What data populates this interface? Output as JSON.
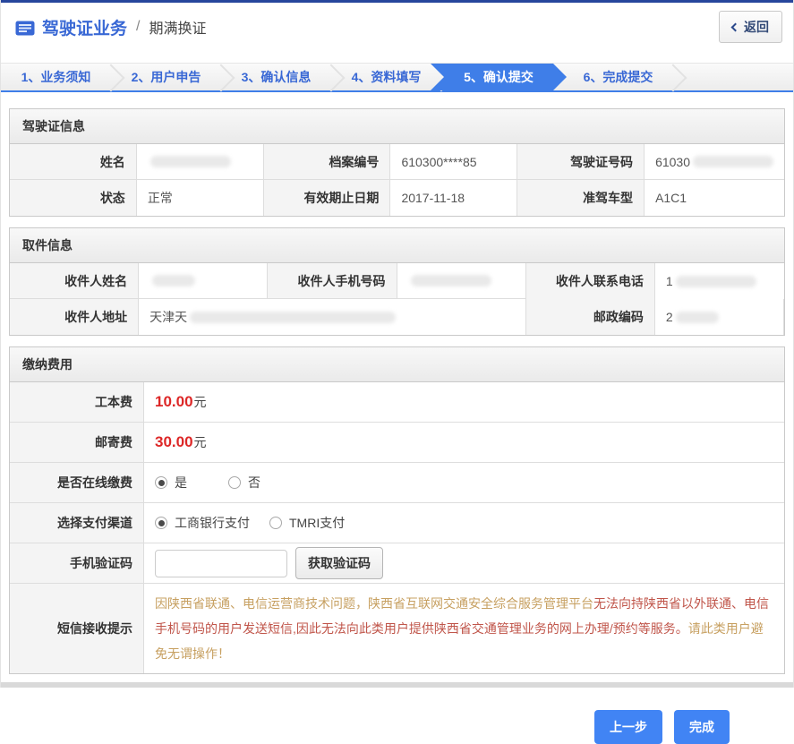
{
  "header": {
    "app_title": "驾驶证业务",
    "separator": "/",
    "subtitle": "期满换证",
    "back_label": "返回"
  },
  "steps": [
    {
      "label": "1、业务须知"
    },
    {
      "label": "2、用户申告"
    },
    {
      "label": "3、确认信息"
    },
    {
      "label": "4、资料填写"
    },
    {
      "label": "5、确认提交"
    },
    {
      "label": "6、完成提交"
    }
  ],
  "license": {
    "title": "驾驶证信息",
    "name_label": "姓名",
    "file_no_label": "档案编号",
    "file_no_value": "610300****85",
    "license_no_label": "驾驶证号码",
    "license_no_value_visible": "61030",
    "status_label": "状态",
    "status_value": "正常",
    "expiry_label": "有效期止日期",
    "expiry_value": "2017-11-18",
    "vehicle_label": "准驾车型",
    "vehicle_value": "A1C1"
  },
  "pickup": {
    "title": "取件信息",
    "recipient_name_label": "收件人姓名",
    "recipient_mobile_label": "收件人手机号码",
    "recipient_tel_label": "收件人联系电话",
    "recipient_tel_value_visible": "1",
    "address_label": "收件人地址",
    "address_value_visible": "天津天",
    "postcode_label": "邮政编码",
    "postcode_value_visible": "2"
  },
  "payment": {
    "title": "缴纳费用",
    "fee_label": "工本费",
    "fee_amount": "10.00",
    "fee_unit": "元",
    "postage_label": "邮寄费",
    "postage_amount": "30.00",
    "postage_unit": "元",
    "online_label": "是否在线缴费",
    "online_yes": "是",
    "online_no": "否",
    "channel_label": "选择支付渠道",
    "channel_icbc": "工商银行支付",
    "channel_tmri": "TMRI支付",
    "sms_label": "手机验证码",
    "sms_button_label": "获取验证码",
    "notice_label": "短信接收提示",
    "notice_part1": "因陕西省联通、电信运营商技术问题，陕西省互联网交通安全综合服务管理平台",
    "notice_part2": "无法向持陕西省以外联通、电信手机号码的用户发送短信,因此无法向此类用户提供陕西省交通管理业务的网上办理/预约等服务。",
    "notice_part3": "请此类用户避免无谓操作！"
  },
  "footer": {
    "prev_label": "上一步",
    "finish_label": "完成"
  },
  "colors": {
    "topbar_blue": "#27469c",
    "link_blue": "#3968d5",
    "accent_blue": "#4184f4",
    "price_red": "#dd2727",
    "notice_tan": "#c7a061",
    "notice_red": "#c0554a"
  }
}
